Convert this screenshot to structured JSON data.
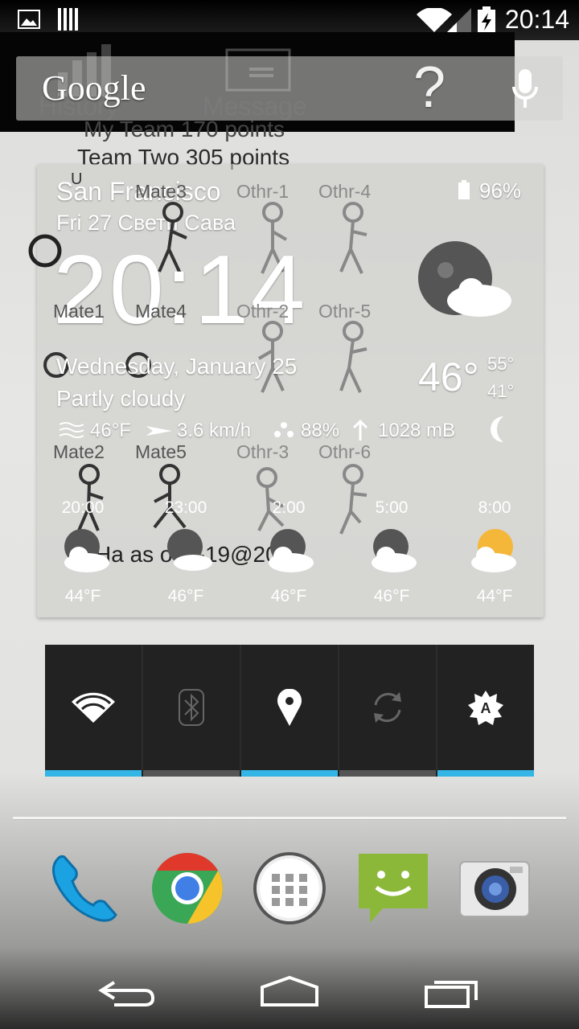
{
  "status": {
    "time": "20:14",
    "icons": [
      "image-icon",
      "barcode-icon",
      "wifi-icon",
      "signal-icon",
      "battery-charging-icon"
    ]
  },
  "game": {
    "history_label": "History",
    "message_label": "Message",
    "my_team_score": "My Team 170 points",
    "team_two_score": "Team Two 305 points",
    "u_label": "U",
    "players": {
      "mate1": "Mate1",
      "mate2": "Mate2",
      "mate3": "Mate3",
      "mate4": "Mate4",
      "mate5": "Mate5",
      "othr1": "Othr-1",
      "othr2": "Othr-2",
      "othr3": "Othr-3",
      "othr4": "Othr-4",
      "othr5": "Othr-5",
      "othr6": "Othr-6"
    },
    "footer_text": "Ha as of 1-19@2017"
  },
  "search": {
    "brand": "Google",
    "help_glyph": "?"
  },
  "weather": {
    "city": "San Francisco",
    "date_line": "Fri 27 Свети Сава",
    "battery": "96%",
    "time": "20:14",
    "full_date": "Wednesday, January 25",
    "condition": "Partly cloudy",
    "current_temp": "46°",
    "high": "55°",
    "low": "41°",
    "feels_like": "46°F",
    "wind": "3.6 km/h",
    "humidity": "88%",
    "pressure": "1028 mB",
    "forecast": [
      {
        "time": "20:00",
        "temp": "44°F",
        "icon": "moon-cloud-icon"
      },
      {
        "time": "23:00",
        "temp": "46°F",
        "icon": "moon-cloud-icon"
      },
      {
        "time": "2:00",
        "temp": "46°F",
        "icon": "moon-cloud-icon"
      },
      {
        "time": "5:00",
        "temp": "46°F",
        "icon": "moon-cloud-icon"
      },
      {
        "time": "8:00",
        "temp": "44°F",
        "icon": "sun-cloud-icon"
      }
    ]
  },
  "power_widget": {
    "toggles": [
      {
        "name": "wifi",
        "state": "on"
      },
      {
        "name": "bluetooth",
        "state": "off"
      },
      {
        "name": "location",
        "state": "on"
      },
      {
        "name": "sync",
        "state": "off"
      },
      {
        "name": "auto-brightness",
        "state": "on"
      }
    ],
    "colors": {
      "on": "#33b5e5",
      "off": "#555555"
    }
  },
  "dock": [
    "phone-icon",
    "chrome-icon",
    "app-drawer-icon",
    "messaging-icon",
    "camera-icon"
  ],
  "colors": {
    "accent": "#33b5e5",
    "sms_green": "#8cb83a"
  }
}
